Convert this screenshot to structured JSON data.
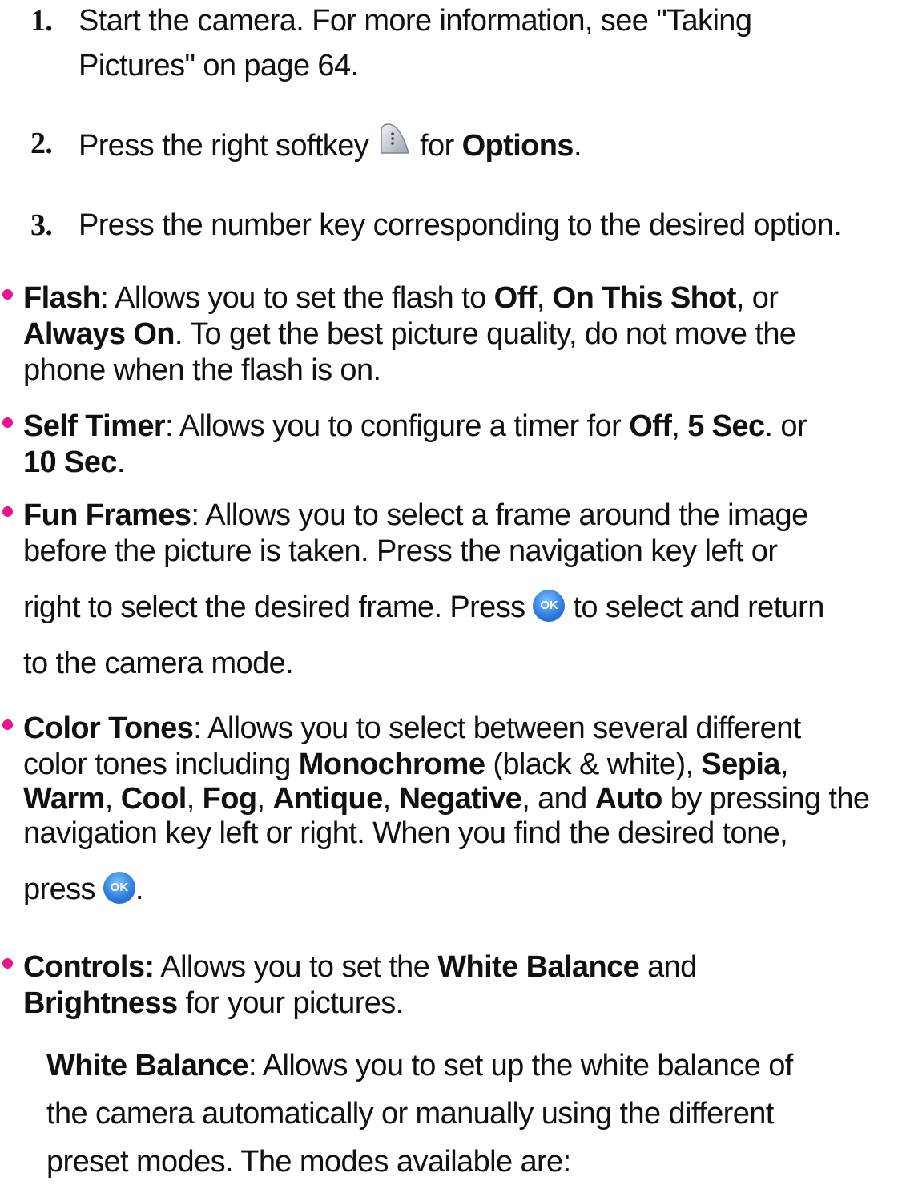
{
  "steps": [
    {
      "num": "1.",
      "line1": "Start the camera. For more information, see \"Taking",
      "line2": "Pictures\" on page 64."
    },
    {
      "num": "2.",
      "pre": "Press the right softkey",
      "mid": "for",
      "bold": "Options",
      "post": "."
    },
    {
      "num": "3.",
      "text": "Press the number key corresponding to the desired option."
    }
  ],
  "bullets": {
    "flash": {
      "title": "Flash",
      "l1a": ": Allows you to set the flash to ",
      "off": "Off",
      "sep1": ", ",
      "on_this_shot": "On This Shot",
      "l1b": ", or",
      "always_on": "Always On",
      "l2": ". To get the best picture quality, do not move the",
      "l3": "phone when the flash is on."
    },
    "self_timer": {
      "title": "Self Timer",
      "l1a": ": Allows you to configure a timer for ",
      "off": "Off",
      "sep1": ", ",
      "five": "5 Sec",
      "l1b": ". or",
      "ten": "10 Sec",
      "l2": "."
    },
    "fun_frames": {
      "title": "Fun Frames",
      "l1": ": Allows you to select a frame around the image",
      "l2": "before the picture is taken. Press the navigation key left or",
      "l3a": "right to select the desired frame. Press",
      "ok": "OK",
      "l3b": "to select and return",
      "l4": "to the camera mode."
    },
    "color_tones": {
      "title": "Color Tones",
      "l1": ": Allows you to select between several different",
      "l2a": "color tones including ",
      "monochrome": "Monochrome",
      "l2b": " (black & white), ",
      "sepia": "Sepia",
      "l2c": ",",
      "warm": "Warm",
      "c1": ", ",
      "cool": "Cool",
      "c2": ", ",
      "fog": "Fog",
      "c3": ", ",
      "antique": "Antique",
      "c4": ", ",
      "negative": "Negative",
      "c5": ", and ",
      "auto": "Auto",
      "l3": " by pressing the",
      "l4": "navigation key left or right. When you find the desired tone,",
      "l5a": "press",
      "ok": "OK",
      "l5b": "."
    },
    "controls": {
      "title": "Controls:",
      "l1a": " Allows you to set the ",
      "white_balance": "White Balance",
      "l1b": " and",
      "brightness": "Brightness",
      "l2": " for your pictures."
    }
  },
  "white_balance": {
    "title": "White Balance",
    "l1": ": Allows you to set up the white balance of",
    "l2": "the camera automatically or manually using the different",
    "l3": "preset modes. The modes available are:"
  },
  "colors": {
    "bullet": "#e8158c",
    "ok_button": "#2f7fe0"
  }
}
